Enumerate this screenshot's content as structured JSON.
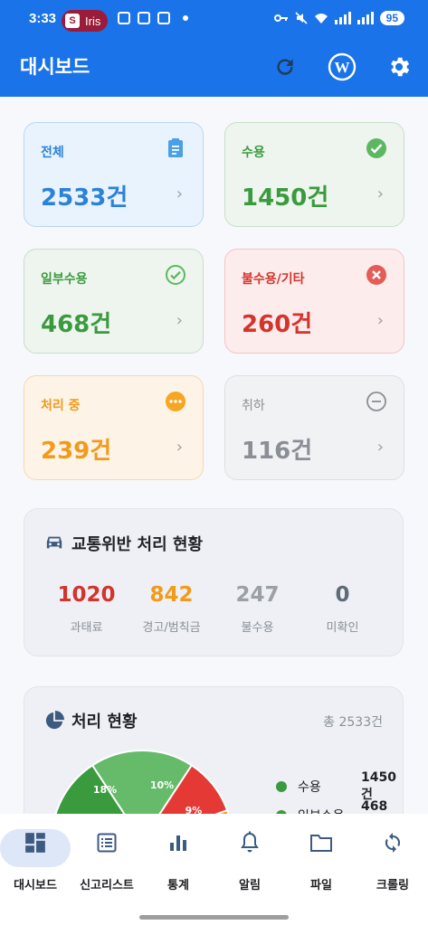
{
  "status_bar": {
    "time": "3:33",
    "app_pill": "Iris",
    "battery": "95"
  },
  "app_bar": {
    "title": "대시보드",
    "icons": [
      "refresh-icon",
      "wordpress-icon",
      "settings-gear-icon"
    ]
  },
  "colors": {
    "primary": "#1a73e8",
    "blue": "#2b82d9",
    "green": "#3a9a3e",
    "red": "#d3342c",
    "orange": "#f29a1a",
    "grey": "#8a8f96"
  },
  "summary_cards": [
    {
      "label": "전체",
      "value": "2533건",
      "icon": "clipboard-icon"
    },
    {
      "label": "수용",
      "value": "1450건",
      "icon": "check-circle-icon"
    },
    {
      "label": "일부수용",
      "value": "468건",
      "icon": "check-circle-outline-icon"
    },
    {
      "label": "불수용/기타",
      "value": "260건",
      "icon": "cancel-circle-icon"
    },
    {
      "label": "처리 중",
      "value": "239건",
      "icon": "more-horizontal-icon"
    },
    {
      "label": "취하",
      "value": "116건",
      "icon": "minus-circle-icon"
    }
  ],
  "traffic_panel": {
    "title": "교통위반 처리 현황",
    "stats": [
      {
        "value": "1020",
        "caption": "과태료"
      },
      {
        "value": "842",
        "caption": "경고/범칙금"
      },
      {
        "value": "247",
        "caption": "불수용"
      },
      {
        "value": "0",
        "caption": "미확인"
      }
    ]
  },
  "process_panel": {
    "title": "처리 현황",
    "total": "총 2533건",
    "legend": [
      {
        "label": "수용",
        "value": "1450건"
      },
      {
        "label": "일부수용",
        "value": "468건"
      }
    ]
  },
  "chart_data": {
    "type": "pie",
    "labels": [
      "수용",
      "일부수용",
      "불수용/기타",
      "처리 중",
      "취하"
    ],
    "values": [
      1450,
      468,
      260,
      239,
      116
    ],
    "visible_slice_labels": [
      "18%",
      "10%",
      "9%"
    ]
  },
  "bottom_nav": [
    {
      "label": "대시보드",
      "icon": "dashboard-icon",
      "active": true
    },
    {
      "label": "신고리스트",
      "icon": "list-icon",
      "active": false
    },
    {
      "label": "통계",
      "icon": "bar-chart-icon",
      "active": false
    },
    {
      "label": "알림",
      "icon": "bell-icon",
      "active": false
    },
    {
      "label": "파일",
      "icon": "folder-icon",
      "active": false
    },
    {
      "label": "크롤링",
      "icon": "sync-icon",
      "active": false
    }
  ]
}
